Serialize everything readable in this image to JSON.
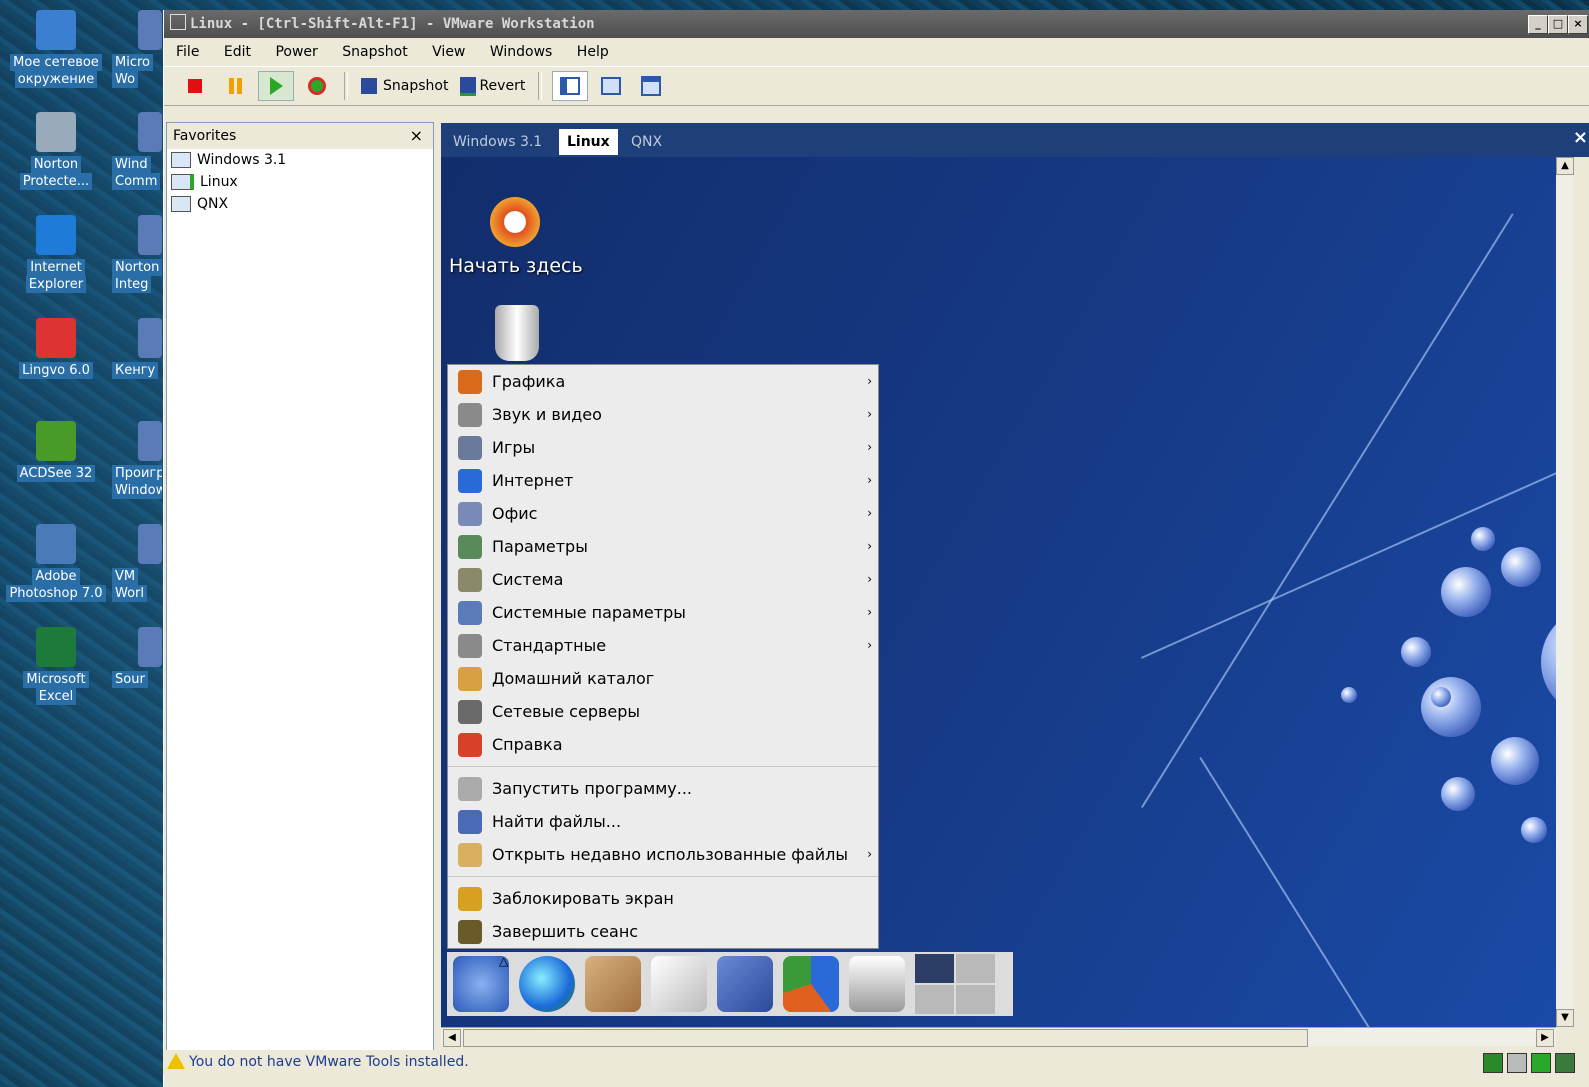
{
  "desktop": {
    "icons": [
      {
        "label1": "Мое сетевое",
        "label2": "окружение",
        "color": "#3b7fd0"
      },
      {
        "label1": "Norton",
        "label2": "Protecte...",
        "color": "#9ab"
      },
      {
        "label1": "Internet",
        "label2": "Explorer",
        "color": "#1e7bd8"
      },
      {
        "label1": "Lingvo 6.0",
        "label2": "",
        "color": "#d33"
      },
      {
        "label1": "ACDSee 32",
        "label2": "",
        "color": "#4a9a2a"
      },
      {
        "label1": "Adobe",
        "label2": "Photoshop 7.0",
        "color": "#4a7ab8"
      },
      {
        "label1": "Microsoft",
        "label2": "Excel",
        "color": "#1d7a3a"
      }
    ],
    "icons2": [
      {
        "label1": "Micro",
        "label2": "Wo"
      },
      {
        "label1": "Wind",
        "label2": "Comm"
      },
      {
        "label1": "Norton",
        "label2": "Integ"
      },
      {
        "label1": "Кенгу",
        "label2": ""
      },
      {
        "label1": "Проигр",
        "label2": "Window"
      },
      {
        "label1": "VM",
        "label2": "Worl"
      },
      {
        "label1": "Sour",
        "label2": ""
      }
    ]
  },
  "window": {
    "title": "Linux - [Ctrl-Shift-Alt-F1] - VMware Workstation",
    "min": "_",
    "max": "□",
    "close": "×"
  },
  "menubar": [
    "File",
    "Edit",
    "Power",
    "Snapshot",
    "View",
    "Windows",
    "Help"
  ],
  "toolbar": {
    "snapshot": "Snapshot",
    "revert": "Revert"
  },
  "favorites": {
    "title": "Favorites",
    "close": "×",
    "items": [
      "Windows 3.1",
      "Linux",
      "QNX"
    ]
  },
  "tabs": {
    "items": [
      "Windows 3.1",
      "Linux",
      "QNX"
    ],
    "close": "×"
  },
  "guest": {
    "icon1": "Начать здесь",
    "menu": [
      {
        "label": "Графика",
        "arrow": "›",
        "color": "#d86a1a"
      },
      {
        "label": "Звук и видео",
        "arrow": "›",
        "color": "#8a8a8a"
      },
      {
        "label": "Игры",
        "arrow": "›",
        "color": "#6a7a9a"
      },
      {
        "label": "Интернет",
        "arrow": "›",
        "color": "#2a6ad8"
      },
      {
        "label": "Офис",
        "arrow": "›",
        "color": "#7a8ab8"
      },
      {
        "label": "Параметры",
        "arrow": "›",
        "color": "#5a8a5a"
      },
      {
        "label": "Система",
        "arrow": "›",
        "color": "#8a8a6a"
      },
      {
        "label": "Системные параметры",
        "arrow": "›",
        "color": "#5a7ab8"
      },
      {
        "label": "Стандартные",
        "arrow": "›",
        "color": "#8a8a8a"
      },
      {
        "label": "Домашний каталог",
        "arrow": "",
        "color": "#d8a040"
      },
      {
        "label": "Сетевые серверы",
        "arrow": "",
        "color": "#6a6a6a"
      },
      {
        "label": "Справка",
        "arrow": "",
        "color": "#d8402a"
      }
    ],
    "menu2": [
      {
        "label": "Запустить программу...",
        "arrow": "",
        "color": "#aaa"
      },
      {
        "label": "Найти файлы...",
        "arrow": "",
        "color": "#4a6ab8"
      },
      {
        "label": "Открыть недавно использованные файлы",
        "arrow": "›",
        "color": "#d8b060"
      }
    ],
    "menu3": [
      {
        "label": "Заблокировать экран",
        "arrow": "",
        "color": "#d8a020"
      },
      {
        "label": "Завершить сеанс",
        "arrow": "",
        "color": "#6a5a2a"
      }
    ],
    "panel_arrow": "△"
  },
  "status": {
    "text": "You do not have VMware Tools installed."
  }
}
